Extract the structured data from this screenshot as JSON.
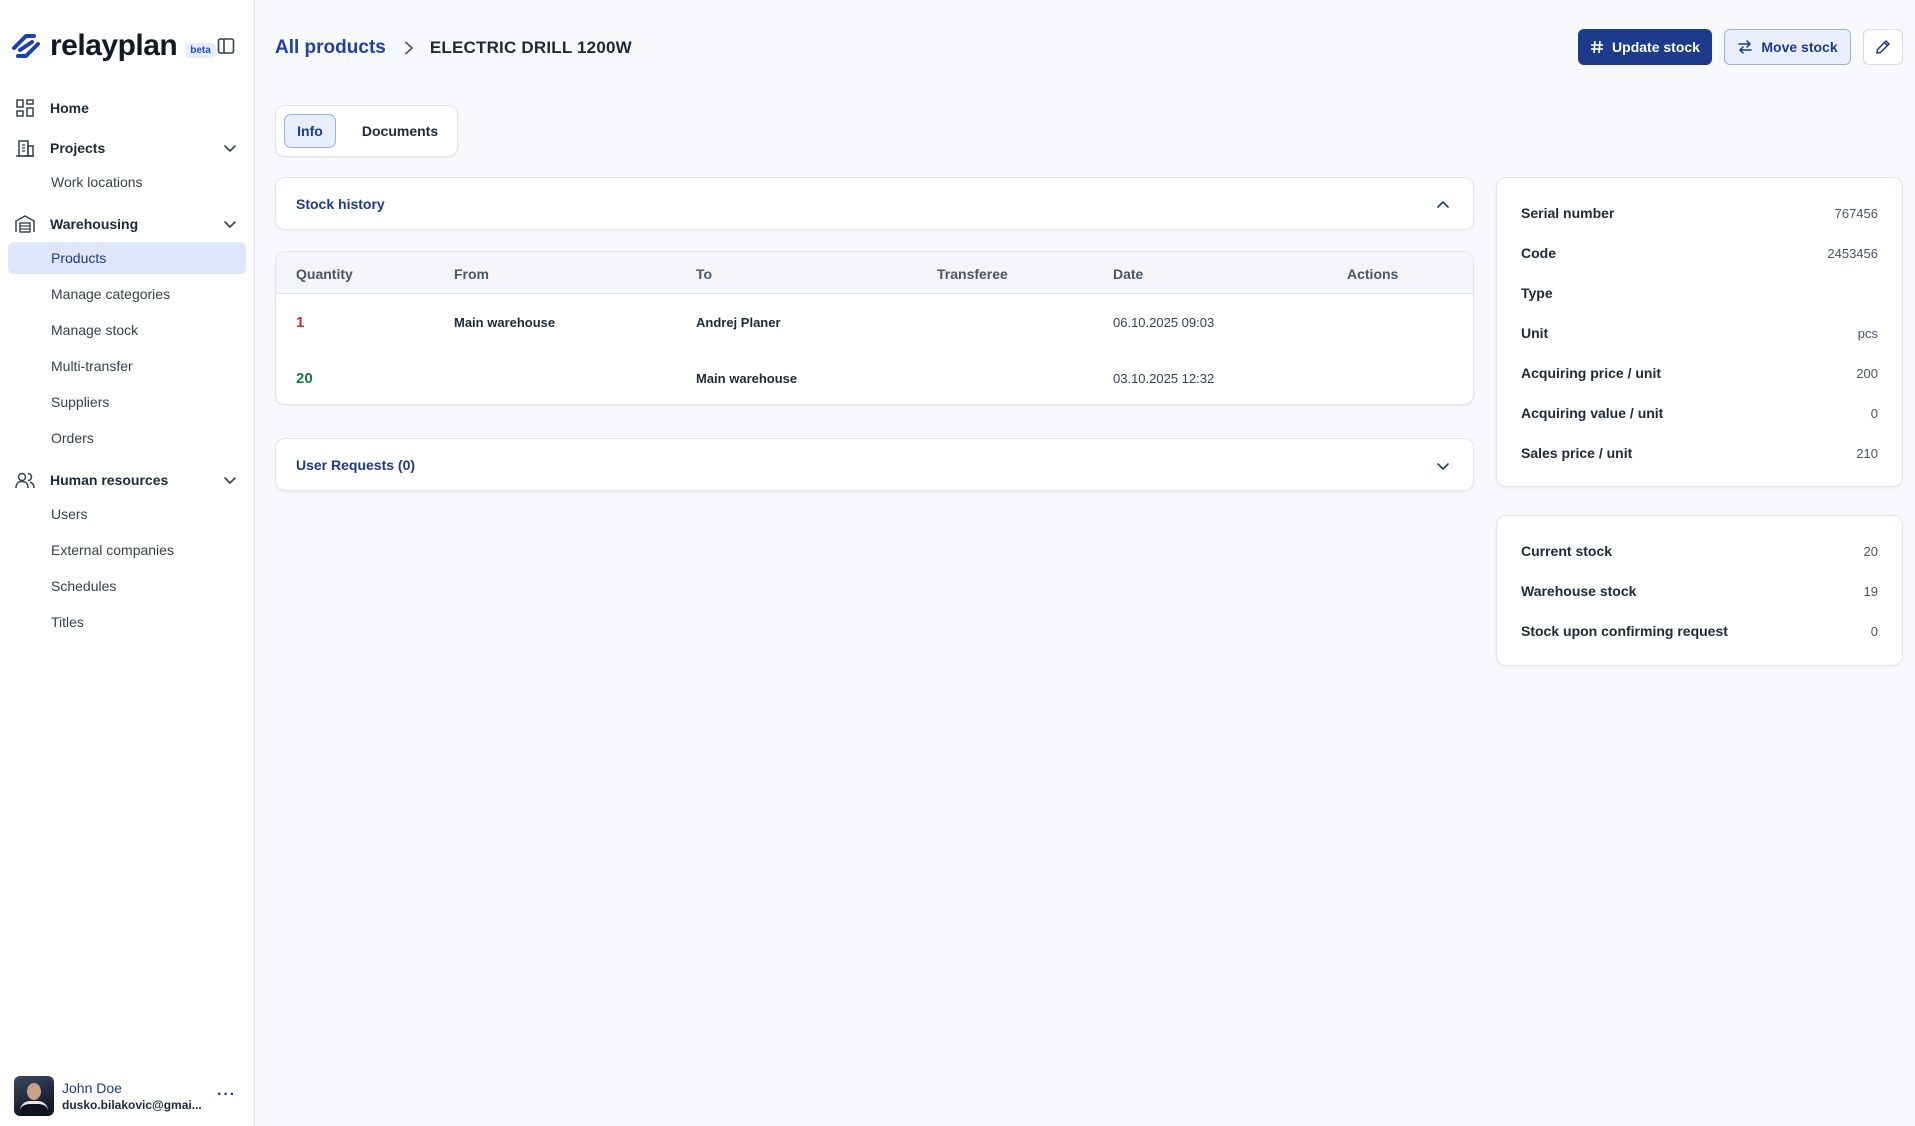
{
  "brand": {
    "name": "relayplan",
    "badge": "beta"
  },
  "sidebar": {
    "home": "Home",
    "projects": {
      "label": "Projects",
      "items": [
        "Work locations"
      ]
    },
    "warehousing": {
      "label": "Warehousing",
      "items": [
        "Products",
        "Manage categories",
        "Manage stock",
        "Multi-transfer",
        "Suppliers",
        "Orders"
      ]
    },
    "hr": {
      "label": "Human resources",
      "items": [
        "Users",
        "External companies",
        "Schedules",
        "Titles"
      ]
    },
    "active_item": "Products"
  },
  "user": {
    "name": "John Doe",
    "email": "dusko.bilakovic@gmai..."
  },
  "header": {
    "breadcrumb_root": "All products",
    "breadcrumb_current": "ELECTRIC DRILL 1200W",
    "update_stock": "Update stock",
    "move_stock": "Move stock"
  },
  "tabs": {
    "info": "Info",
    "documents": "Documents",
    "active": "Info"
  },
  "stock_history": {
    "title": "Stock history",
    "columns": [
      "Quantity",
      "From",
      "To",
      "Transferee",
      "Date",
      "Actions"
    ],
    "rows": [
      {
        "quantity": "1",
        "from": "Main warehouse",
        "to": "Andrej Planer",
        "transferee": "",
        "date": "06.10.2025 09:03",
        "direction": "out"
      },
      {
        "quantity": "20",
        "from": "",
        "to": "Main warehouse",
        "transferee": "",
        "date": "03.10.2025 12:32",
        "direction": "in"
      }
    ]
  },
  "user_requests": {
    "title": "User Requests (0)"
  },
  "details": [
    {
      "label": "Serial number",
      "value": "767456"
    },
    {
      "label": "Code",
      "value": "2453456"
    },
    {
      "label": "Type",
      "value": ""
    },
    {
      "label": "Unit",
      "value": "pcs"
    },
    {
      "label": "Acquiring price / unit",
      "value": "200"
    },
    {
      "label": "Acquiring value / unit",
      "value": "0"
    },
    {
      "label": "Sales price / unit",
      "value": "210"
    }
  ],
  "stock": [
    {
      "label": "Current stock",
      "value": "20"
    },
    {
      "label": "Warehouse stock",
      "value": "19"
    },
    {
      "label": "Stock upon confirming request",
      "value": "0"
    }
  ],
  "colors": {
    "primary": "#1e3a8a",
    "link": "#1e40af",
    "negative": "#dc2626",
    "positive": "#15803d",
    "active_bg": "#dfe7fa"
  }
}
